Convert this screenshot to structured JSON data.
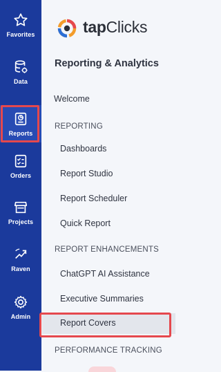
{
  "rail": {
    "items": [
      {
        "label": "Favorites",
        "icon": "star-icon"
      },
      {
        "label": "Data",
        "icon": "database-icon"
      },
      {
        "label": "Reports",
        "icon": "report-icon",
        "active": true
      },
      {
        "label": "Orders",
        "icon": "checklist-icon"
      },
      {
        "label": "Projects",
        "icon": "store-icon"
      },
      {
        "label": "Raven",
        "icon": "trend-icon"
      },
      {
        "label": "Admin",
        "icon": "gear-icon"
      }
    ],
    "background": "#1b3a9c"
  },
  "panel": {
    "logo": {
      "bold": "tap",
      "rest": "Clicks"
    },
    "title": "Reporting & Analytics",
    "welcome": "Welcome",
    "reporting_header": "REPORTING",
    "reporting_items": [
      "Dashboards",
      "Report Studio",
      "Report Scheduler",
      "Quick Report"
    ],
    "enhancements_header": "REPORT ENHANCEMENTS",
    "enhancement_items": [
      "ChatGPT AI Assistance",
      "Executive Summaries",
      "Report Covers"
    ],
    "performance_header": "PERFORMANCE TRACKING",
    "selected_item": "Report Covers"
  },
  "colors": {
    "highlight": "#e5484d",
    "accent_orange": "#f39c2b",
    "accent_blue": "#2d6fd6"
  }
}
